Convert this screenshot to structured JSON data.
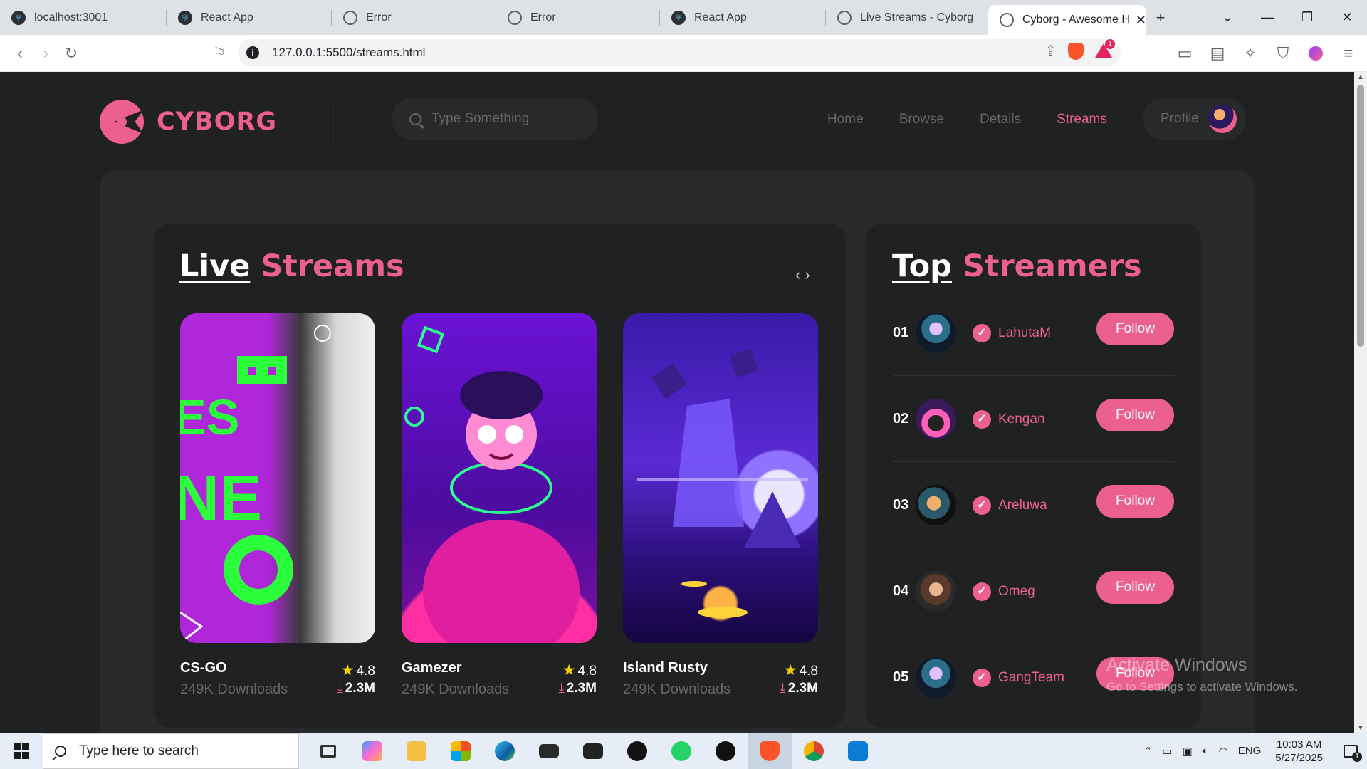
{
  "browser": {
    "tabs": [
      {
        "title": "localhost:3001",
        "icon": "react-icon"
      },
      {
        "title": "React App",
        "icon": "react-icon"
      },
      {
        "title": "Error",
        "icon": "globe-icon"
      },
      {
        "title": "Error",
        "icon": "globe-icon"
      },
      {
        "title": "React App",
        "icon": "react-icon"
      },
      {
        "title": "Live Streams - Cyborg",
        "icon": "globe-icon"
      },
      {
        "title": "Cyborg - Awesome H",
        "icon": "globe-icon",
        "active": true
      }
    ],
    "url": "127.0.0.1:5500/streams.html",
    "rewards_badge": "1"
  },
  "site": {
    "logo_text": "CYBORG",
    "search_placeholder": "Type Something",
    "nav": [
      "Home",
      "Browse",
      "Details",
      "Streams"
    ],
    "profile_label": "Profile",
    "accent_color": "#ec6090"
  },
  "live_streams": {
    "heading_white": "Live",
    "heading_pink": "Streams",
    "cards": [
      {
        "title": "CS-GO",
        "downloads_label": "249K Downloads",
        "rating": "4.8",
        "downloads": "2.3M"
      },
      {
        "title": "Gamezer",
        "downloads_label": "249K Downloads",
        "rating": "4.8",
        "downloads": "2.3M"
      },
      {
        "title": "Island Rusty",
        "downloads_label": "249K Downloads",
        "rating": "4.8",
        "downloads": "2.3M"
      }
    ]
  },
  "top_streamers": {
    "heading_white": "Top",
    "heading_pink": "Streamers",
    "follow_label": "Follow",
    "items": [
      {
        "rank": "01",
        "name": "LahutaM"
      },
      {
        "rank": "02",
        "name": "Kengan"
      },
      {
        "rank": "03",
        "name": "Areluwa"
      },
      {
        "rank": "04",
        "name": "Omeg"
      },
      {
        "rank": "05",
        "name": "GangTeam"
      }
    ]
  },
  "watermark": {
    "title": "Activate Windows",
    "subtitle": "Go to Settings to activate Windows."
  },
  "taskbar": {
    "search_placeholder": "Type here to search",
    "language": "ENG",
    "time": "10:03 AM",
    "date": "5/27/2025",
    "notification_count": "1"
  }
}
